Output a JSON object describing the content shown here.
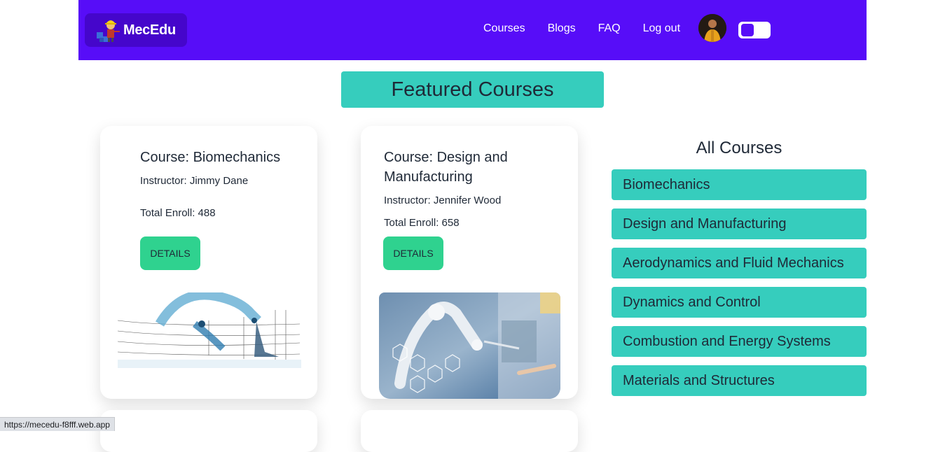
{
  "brand": {
    "name": "MecEdu"
  },
  "nav": {
    "links": [
      "Courses",
      "Blogs",
      "FAQ",
      "Log out"
    ]
  },
  "featured": {
    "title": "Featured Courses"
  },
  "cards": [
    {
      "title": "Course: Biomechanics",
      "instructor": "Instructor: Jimmy Dane",
      "enroll": "Total Enroll: 488",
      "button": "DETAILS"
    },
    {
      "title_line1": "Course: Design and",
      "title_line2": "Manufacturing",
      "instructor": "Instructor: Jennifer Wood",
      "enroll": "Total Enroll: 658",
      "button": "DETAILS"
    }
  ],
  "all_courses": {
    "title": "All Courses",
    "items": [
      "Biomechanics",
      "Design and Manufacturing",
      "Aerodynamics and Fluid Mechanics",
      "Dynamics and Control",
      "Combustion and Energy Systems",
      "Materials and Structures"
    ]
  },
  "status_bar": {
    "url": "https://mecedu-f8fff.web.app"
  },
  "colors": {
    "primary": "#570df8",
    "accent": "#36cdbd",
    "success": "#2fd28f"
  }
}
